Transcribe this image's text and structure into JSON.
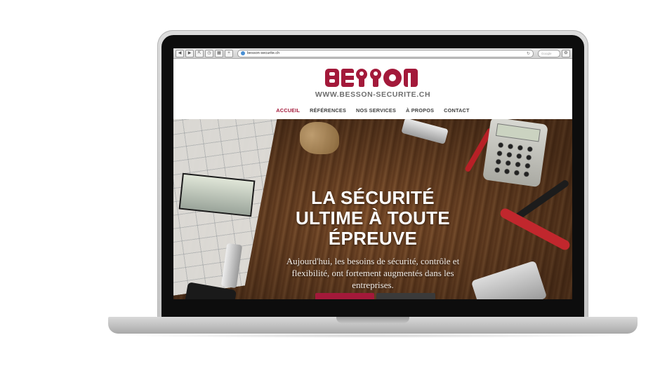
{
  "browser": {
    "url": "besson-securite.ch",
    "search_placeholder": "Google"
  },
  "site": {
    "logo_text": "BESSON",
    "logo_url": "WWW.BESSON-SECURITE.CH",
    "brand_color": "#a3193a"
  },
  "nav": {
    "items": [
      {
        "label": "ACCUEIL",
        "active": true
      },
      {
        "label": "RÉFÉRENCES"
      },
      {
        "label": "NOS SERVICES"
      },
      {
        "label": "À PROPOS"
      },
      {
        "label": "CONTACT"
      }
    ]
  },
  "hero": {
    "title_line1": "LA SÉCURITÉ",
    "title_line2": "ULTIME À TOUTE",
    "title_line3": "ÉPREUVE",
    "subtitle": "Aujourd'hui, les besoins de sécurité, contrôle et flexibilité, ont fortement augmentés dans les entreprises."
  }
}
